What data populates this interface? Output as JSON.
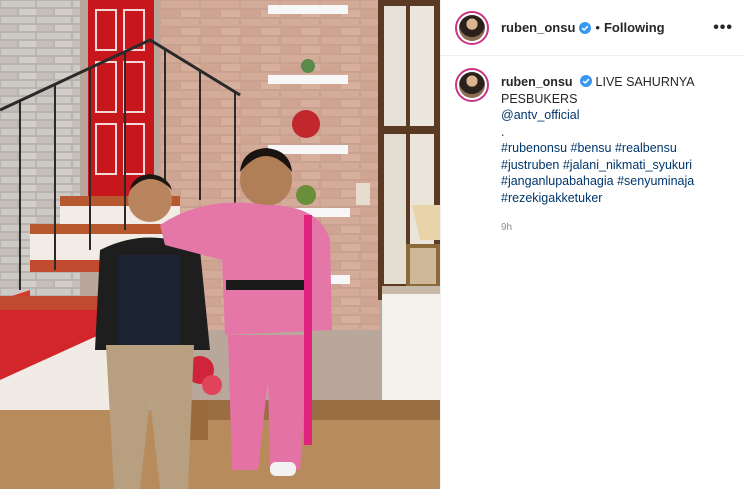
{
  "post": {
    "username": "ruben_onsu",
    "follow_status": "Following",
    "more_label": "•••",
    "caption": {
      "username": "ruben_onsu",
      "text": "LIVE SAHURNYA PESBUKERS",
      "mention": "@antv_official",
      "separator": ".",
      "hashtag_lines": [
        "#rubenonsu #bensu #realbensu",
        "#justruben #jalani_nikmati_syukuri",
        "#janganlupabahagia #senyuminaja",
        "#rezekigakketuker"
      ]
    },
    "time_ago": "9h"
  },
  "colors": {
    "link": "#00376b",
    "verified": "#3897f0",
    "avatar_ring": "#c93582",
    "muted": "#8e8e8e"
  },
  "icons": {
    "verified": "verified-badge-icon",
    "more": "more-options-icon"
  }
}
